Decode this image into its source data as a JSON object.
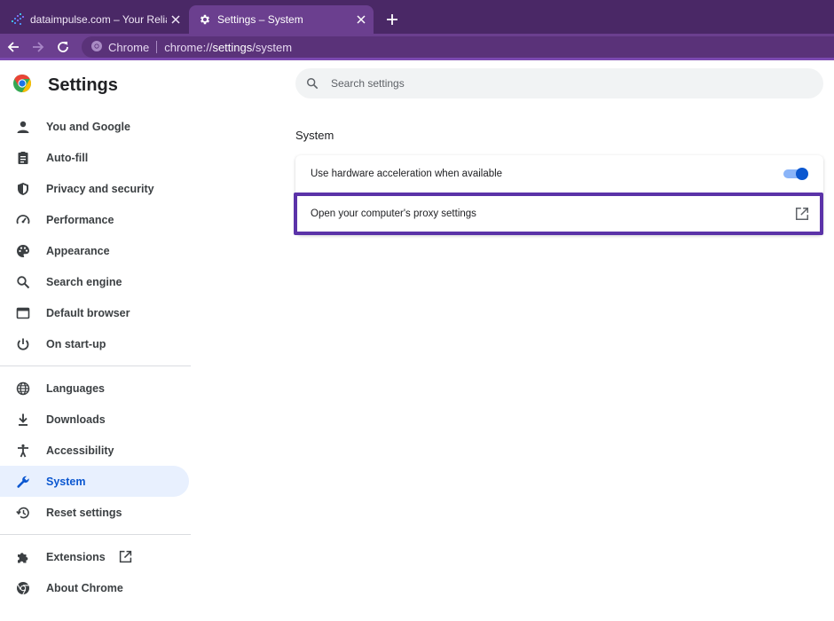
{
  "tabs": [
    {
      "title": "dataimpulse.com – Your Reliab",
      "favicon": "dataimpulse-logo-icon",
      "active": false
    },
    {
      "title": "Settings – System",
      "favicon": "gear-icon",
      "active": true
    }
  ],
  "omnibox": {
    "site_label": "Chrome",
    "url_prefix": "chrome://",
    "url_host": "settings",
    "url_path": "/system"
  },
  "sidebar": {
    "title": "Settings",
    "items": [
      {
        "label": "You and Google",
        "icon": "person-icon"
      },
      {
        "label": "Auto-fill",
        "icon": "clipboard-icon"
      },
      {
        "label": "Privacy and security",
        "icon": "shield-icon"
      },
      {
        "label": "Performance",
        "icon": "speedometer-icon"
      },
      {
        "label": "Appearance",
        "icon": "palette-icon"
      },
      {
        "label": "Search engine",
        "icon": "search-icon"
      },
      {
        "label": "Default browser",
        "icon": "browser-window-icon"
      },
      {
        "label": "On start-up",
        "icon": "power-icon"
      },
      {
        "label": "Languages",
        "icon": "globe-icon"
      },
      {
        "label": "Downloads",
        "icon": "download-icon"
      },
      {
        "label": "Accessibility",
        "icon": "accessibility-icon"
      },
      {
        "label": "System",
        "icon": "wrench-icon",
        "active": true
      },
      {
        "label": "Reset settings",
        "icon": "history-icon"
      },
      {
        "label": "Extensions",
        "icon": "puzzle-icon"
      },
      {
        "label": "About Chrome",
        "icon": "chrome-icon"
      }
    ]
  },
  "search": {
    "placeholder": "Search settings"
  },
  "main": {
    "section_title": "System",
    "hw_accel_label": "Use hardware acceleration when available",
    "hw_accel_enabled": true,
    "proxy_label": "Open your computer's proxy settings"
  },
  "colors": {
    "accent": "#0b57d0",
    "frame": "#4a2866",
    "toolbar": "#6b3f8f",
    "highlight": "#5b33a8"
  }
}
